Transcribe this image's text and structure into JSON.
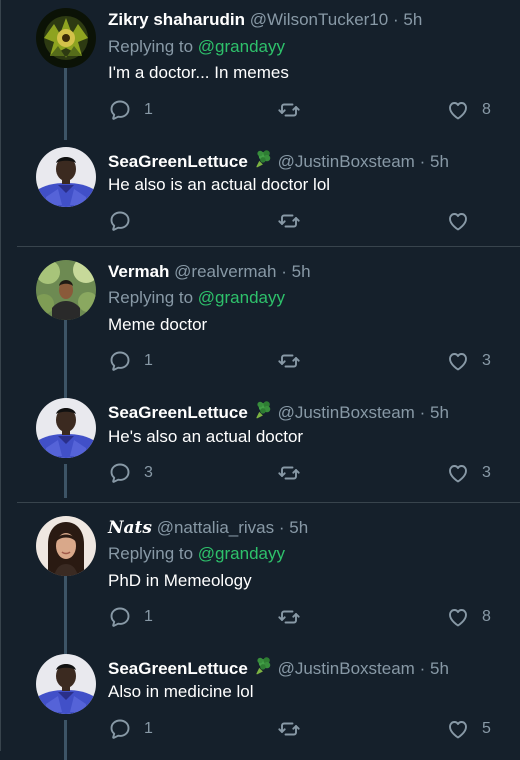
{
  "theme": {
    "background": "#15202b",
    "muted": "#8899a6",
    "mention": "#2ec16b",
    "text": "#ffffff",
    "thread_line": "#3d5466",
    "divider": "#38444d"
  },
  "replying_prefix": "Replying to",
  "tweets": [
    {
      "name": "Zikry shaharudin",
      "handle": "@WilsonTucker10",
      "dot": "·",
      "time": "5h",
      "reply_to": "@grandayy",
      "text": "I'm a doctor... In memes",
      "replies": "1",
      "retweets": "",
      "likes": "8"
    },
    {
      "name": "SeaGreenLettuce",
      "emoji": "broccoli-emoji",
      "handle": "@JustinBoxsteam",
      "dot": "·",
      "time": "5h",
      "text": "He also is an actual doctor lol",
      "replies": "",
      "retweets": "",
      "likes": ""
    },
    {
      "name": "Vermah",
      "handle": "@realvermah",
      "dot": "·",
      "time": "5h",
      "reply_to": "@grandayy",
      "text": "Meme doctor",
      "replies": "1",
      "retweets": "",
      "likes": "3"
    },
    {
      "name": "SeaGreenLettuce",
      "emoji": "broccoli-emoji",
      "handle": "@JustinBoxsteam",
      "dot": "·",
      "time": "5h",
      "text": "He's also an actual doctor",
      "replies": "3",
      "retweets": "",
      "likes": "3"
    },
    {
      "name": "Nats",
      "handle": "@nattalia_rivas",
      "dot": "·",
      "time": "5h",
      "reply_to": "@grandayy",
      "text": "PhD in Memeology",
      "replies": "1",
      "retweets": "",
      "likes": "8"
    },
    {
      "name": "SeaGreenLettuce",
      "emoji": "broccoli-emoji",
      "handle": "@JustinBoxsteam",
      "dot": "·",
      "time": "5h",
      "text": "Also in medicine lol",
      "replies": "1",
      "retweets": "",
      "likes": "5"
    }
  ]
}
